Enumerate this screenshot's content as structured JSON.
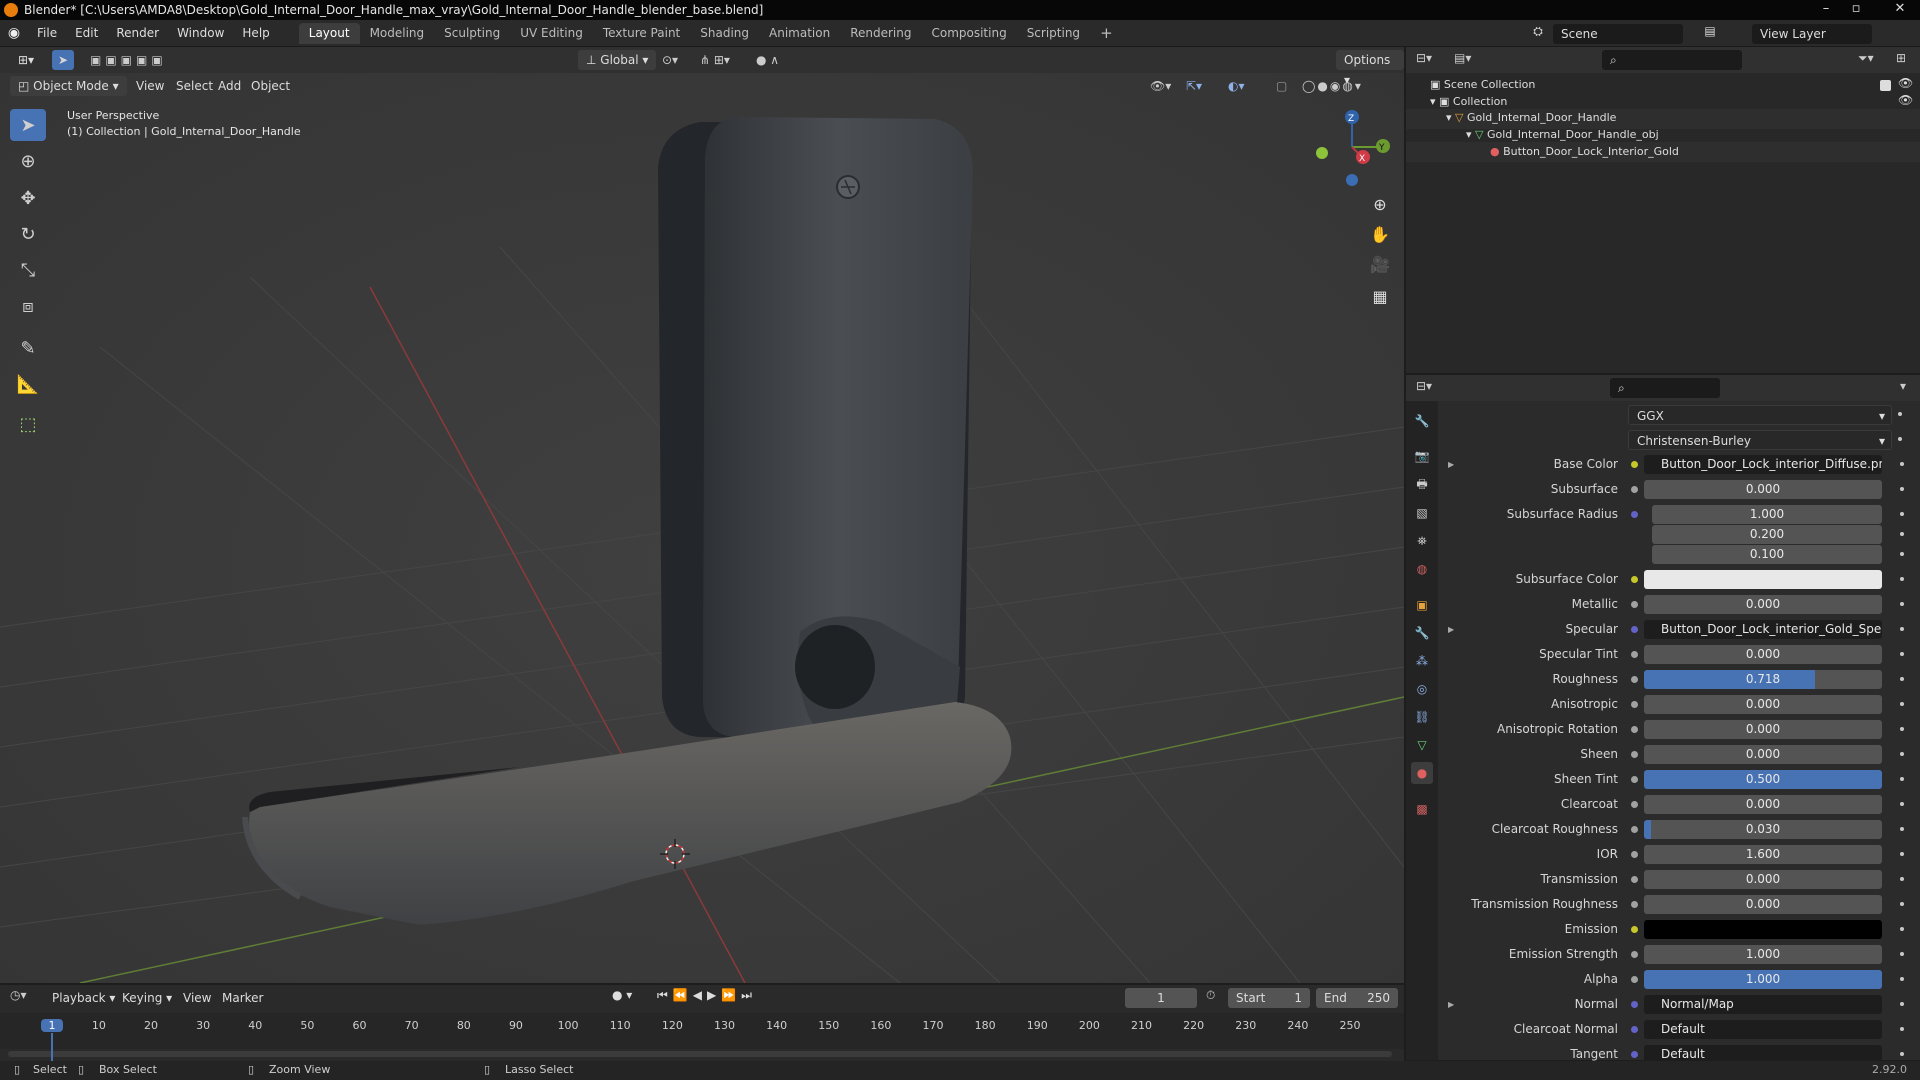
{
  "window": {
    "title": "Blender* [C:\\Users\\AMDA8\\Desktop\\Gold_Internal_Door_Handle_max_vray\\Gold_Internal_Door_Handle_blender_base.blend]"
  },
  "menu": [
    "File",
    "Edit",
    "Render",
    "Window",
    "Help"
  ],
  "workspaces": [
    "Layout",
    "Modeling",
    "Sculpting",
    "UV Editing",
    "Texture Paint",
    "Shading",
    "Animation",
    "Rendering",
    "Compositing",
    "Scripting"
  ],
  "scene": {
    "name": "Scene",
    "view_layer": "View Layer"
  },
  "viewport": {
    "transform": "Global",
    "options": "Options",
    "mode": "Object Mode",
    "menus": [
      "View",
      "Select",
      "Add",
      "Object"
    ],
    "info_line1": "User Perspective",
    "info_line2": "(1) Collection | Gold_Internal_Door_Handle",
    "gizmo": {
      "x": "X",
      "y": "Y",
      "z": "Z"
    }
  },
  "outliner": {
    "root": "Scene Collection",
    "collection": "Collection",
    "object": "Gold_Internal_Door_Handle",
    "mesh": "Gold_Internal_Door_Handle_obj",
    "material": "Button_Door_Lock_Interior_Gold"
  },
  "properties": {
    "distribution": "GGX",
    "subsurface_method": "Christensen-Burley",
    "rows": [
      {
        "label": "Base Color",
        "value": "Button_Door_Lock_interior_Diffuse.png",
        "kind": "link",
        "dot": "#c7c729",
        "arrow": true
      },
      {
        "label": "Subsurface",
        "value": "0.000",
        "kind": "num",
        "dot": "#a1a1a1",
        "fill": 0
      },
      {
        "label": "Subsurface Radius",
        "value": "1.000",
        "kind": "num",
        "dot": "#6363c7",
        "fill": 0
      },
      {
        "label": "",
        "value": "0.200",
        "kind": "num",
        "dot": "",
        "fill": 0
      },
      {
        "label": "",
        "value": "0.100",
        "kind": "num",
        "dot": "",
        "fill": 0
      },
      {
        "label": "Subsurface Color",
        "value": "",
        "kind": "color",
        "dot": "#c7c729",
        "color": "#e8e8e8"
      },
      {
        "label": "Metallic",
        "value": "0.000",
        "kind": "num",
        "dot": "#a1a1a1",
        "fill": 0
      },
      {
        "label": "Specular",
        "value": "Button_Door_Lock_interior_Gold_Specular.png",
        "kind": "link",
        "dot": "#6363c7",
        "arrow": true
      },
      {
        "label": "Specular Tint",
        "value": "0.000",
        "kind": "num",
        "dot": "#a1a1a1",
        "fill": 0
      },
      {
        "label": "Roughness",
        "value": "0.718",
        "kind": "num",
        "dot": "#a1a1a1",
        "fill": 0.718
      },
      {
        "label": "Anisotropic",
        "value": "0.000",
        "kind": "num",
        "dot": "#a1a1a1",
        "fill": 0
      },
      {
        "label": "Anisotropic Rotation",
        "value": "0.000",
        "kind": "num",
        "dot": "#a1a1a1",
        "fill": 0
      },
      {
        "label": "Sheen",
        "value": "0.000",
        "kind": "num",
        "dot": "#a1a1a1",
        "fill": 0
      },
      {
        "label": "Sheen Tint",
        "value": "0.500",
        "kind": "num",
        "dot": "#a1a1a1",
        "fill": 1
      },
      {
        "label": "Clearcoat",
        "value": "0.000",
        "kind": "num",
        "dot": "#a1a1a1",
        "fill": 0
      },
      {
        "label": "Clearcoat Roughness",
        "value": "0.030",
        "kind": "num",
        "dot": "#a1a1a1",
        "fill": 0.03
      },
      {
        "label": "IOR",
        "value": "1.600",
        "kind": "num",
        "dot": "#a1a1a1",
        "fill": 0
      },
      {
        "label": "Transmission",
        "value": "0.000",
        "kind": "num",
        "dot": "#a1a1a1",
        "fill": 0
      },
      {
        "label": "Transmission Roughness",
        "value": "0.000",
        "kind": "num",
        "dot": "#a1a1a1",
        "fill": 0
      },
      {
        "label": "Emission",
        "value": "",
        "kind": "color",
        "dot": "#c7c729",
        "color": "#000000"
      },
      {
        "label": "Emission Strength",
        "value": "1.000",
        "kind": "num",
        "dot": "#a1a1a1",
        "fill": 0
      },
      {
        "label": "Alpha",
        "value": "1.000",
        "kind": "num",
        "dot": "#a1a1a1",
        "fill": 1
      },
      {
        "label": "Normal",
        "value": "Normal/Map",
        "kind": "link",
        "dot": "#6363c7",
        "arrow": true
      },
      {
        "label": "Clearcoat Normal",
        "value": "Default",
        "kind": "link",
        "dot": "#6363c7"
      },
      {
        "label": "Tangent",
        "value": "Default",
        "kind": "link",
        "dot": "#6363c7"
      }
    ]
  },
  "timeline": {
    "menus": [
      "Playback",
      "Keying",
      "View",
      "Marker"
    ],
    "current_frame": "1",
    "start_label": "Start",
    "start": "1",
    "end_label": "End",
    "end": "250",
    "ticks": [
      "1",
      "10",
      "20",
      "30",
      "40",
      "50",
      "60",
      "70",
      "80",
      "90",
      "100",
      "110",
      "120",
      "130",
      "140",
      "150",
      "160",
      "170",
      "180",
      "190",
      "200",
      "210",
      "220",
      "230",
      "240",
      "250"
    ]
  },
  "status": {
    "select": "Select",
    "box_select": "Box Select",
    "zoom_view": "Zoom View",
    "lasso_select": "Lasso Select",
    "version": "2.92.0"
  }
}
